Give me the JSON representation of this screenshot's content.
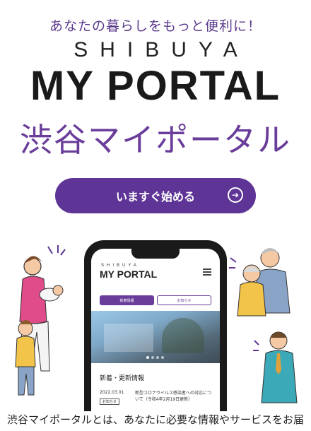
{
  "hero": {
    "tagline": "あなたの暮らしをもっと便利に！",
    "brand_top": "SHIBUYA",
    "brand_main": "MY PORTAL",
    "brand_jp": "渋谷マイポータル"
  },
  "cta": {
    "label": "いますぐ始める",
    "icon": "arrow-circle-right-icon"
  },
  "phone_screen": {
    "brand_small": "SHIBUYA",
    "brand": "MY PORTAL",
    "menu_icon": "hamburger-menu-icon",
    "tabs": [
      {
        "label": "新着情報",
        "active": true
      },
      {
        "label": "お知らせ",
        "active": false
      }
    ],
    "section_title": "新着・更新情報",
    "news": {
      "date": "2022.03.01",
      "tag": "お知らせ",
      "text": "新型コロナウイルス感染者への対応について（令和4年2月19日更新）"
    }
  },
  "caption": "渋谷マイポータルとは、あなたに必要な情報やサービスをお届",
  "colors": {
    "accent": "#5e3596",
    "brand_purple": "#6a3d9a",
    "text_dark": "#1a1a1a"
  }
}
